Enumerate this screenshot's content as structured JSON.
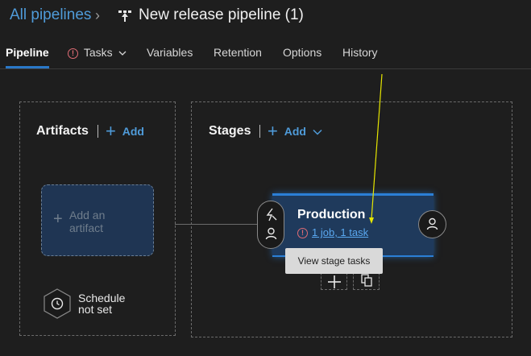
{
  "header": {
    "breadcrumb_root": "All pipelines",
    "breadcrumb_separator": "›",
    "pipeline_icon": "pipeline-icon",
    "title": "New release pipeline (1)"
  },
  "tabs": [
    {
      "label": "Pipeline",
      "active": true
    },
    {
      "label": "Tasks",
      "warning": true,
      "dropdown": true
    },
    {
      "label": "Variables"
    },
    {
      "label": "Retention"
    },
    {
      "label": "Options"
    },
    {
      "label": "History"
    }
  ],
  "artifacts": {
    "title": "Artifacts",
    "add_label": "Add",
    "add_artifact_line1": "Add an",
    "add_artifact_line2": "artifact",
    "schedule_line1": "Schedule",
    "schedule_line2": "not set"
  },
  "stages": {
    "title": "Stages",
    "add_label": "Add",
    "stage": {
      "name": "Production",
      "tasks_link": "1 job, 1 task"
    },
    "tooltip": "View stage tasks"
  },
  "colors": {
    "accent": "#4f9bd9",
    "stage_border": "#2b7fd6",
    "warning": "#e06c75",
    "annotation_arrow": "#e6e600"
  }
}
